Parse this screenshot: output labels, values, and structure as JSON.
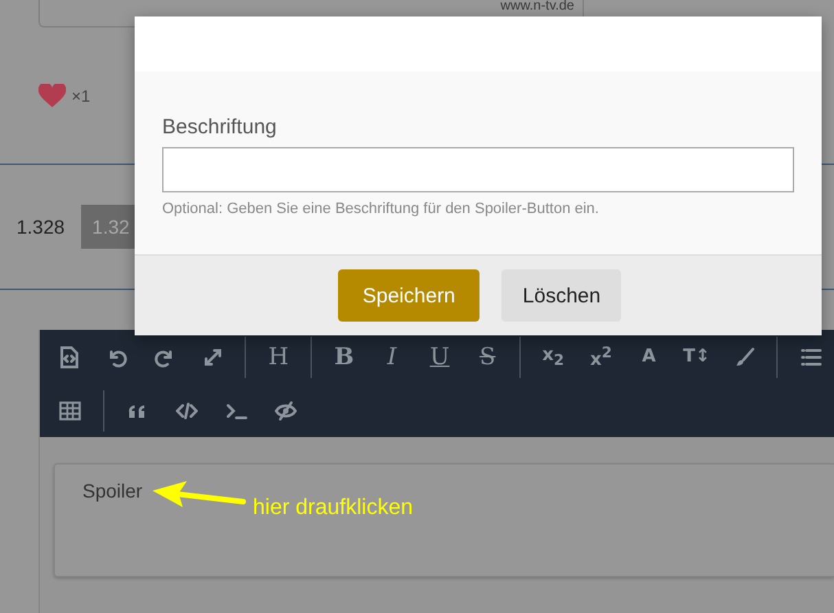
{
  "background": {
    "source_link": "www.n-tv.de",
    "reaction": {
      "count": "×1"
    },
    "counter": {
      "value": "1.328",
      "next_value": "1.32"
    }
  },
  "dialog": {
    "field": {
      "label": "Beschriftung",
      "help": "Optional: Geben Sie eine Beschriftung für den Spoiler-Button ein."
    },
    "buttons": [
      {
        "label": "Speichern",
        "kind": "primary"
      },
      {
        "label": "Löschen",
        "kind": "secondary"
      }
    ]
  },
  "toolbar": {
    "rows": [
      [
        {
          "kind": "icon"
        },
        {
          "kind": "icon"
        },
        {
          "kind": "icon"
        },
        {
          "kind": "icon"
        },
        {
          "kind": "separator"
        },
        {
          "kind": "glyph",
          "text": "H"
        },
        {
          "kind": "separator"
        },
        {
          "kind": "glyph",
          "text": "B"
        },
        {
          "kind": "glyph",
          "text": "I"
        },
        {
          "kind": "glyph",
          "text": "U"
        },
        {
          "kind": "glyph",
          "text": "S"
        },
        {
          "kind": "separator"
        },
        {
          "kind": "glyph",
          "text": "x$_{2}$"
        },
        {
          "kind": "glyph",
          "text": "x$^{2}$"
        },
        {
          "kind": "glyph",
          "text": "A"
        },
        {
          "kind": "glyph",
          "text": "T↕"
        },
        {
          "kind": "icon"
        },
        {
          "kind": "separator"
        },
        {
          "kind": "icon"
        }
      ],
      [
        {
          "kind": "icon"
        },
        {
          "kind": "separator"
        },
        {
          "kind": "icon"
        },
        {
          "kind": "icon"
        },
        {
          "kind": "icon"
        },
        {
          "kind": "icon"
        }
      ]
    ]
  },
  "editor": {
    "spoiler_label": "Spoiler"
  },
  "annotation": {
    "text": "hier draufklicken"
  }
}
